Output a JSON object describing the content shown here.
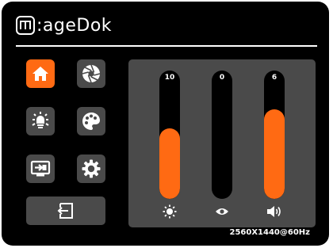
{
  "brand": {
    "name": ":ageDok"
  },
  "colors": {
    "accent": "#ff6a13",
    "button_bg": "#4a4a4a",
    "background": "#000000"
  },
  "menu": {
    "items": [
      {
        "icon": "home-icon",
        "active": true
      },
      {
        "icon": "aperture-icon",
        "active": false
      },
      {
        "icon": "bulb-icon",
        "active": false
      },
      {
        "icon": "palette-icon",
        "active": false
      },
      {
        "icon": "input-source-icon",
        "active": false
      },
      {
        "icon": "gear-icon",
        "active": false
      }
    ],
    "exit_icon": "exit-icon"
  },
  "sliders": [
    {
      "name": "brightness",
      "icon": "sun-icon",
      "value": "10",
      "level": 0.55
    },
    {
      "name": "eye-care",
      "icon": "eye-icon",
      "value": "0",
      "level": 0.0
    },
    {
      "name": "volume",
      "icon": "speaker-icon",
      "value": "6",
      "level": 0.7
    }
  ],
  "status": {
    "resolution": "2560X1440@60Hz"
  }
}
